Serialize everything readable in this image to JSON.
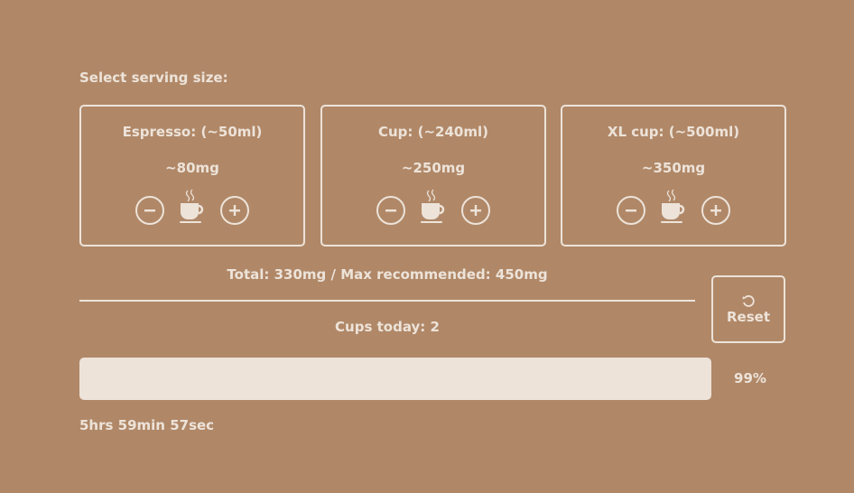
{
  "select_label": "Select serving size:",
  "servings": [
    {
      "title": "Espresso: (~50ml)",
      "caffeine": "~80mg"
    },
    {
      "title": "Cup: (~240ml)",
      "caffeine": "~250mg"
    },
    {
      "title": "XL cup: (~500ml)",
      "caffeine": "~350mg"
    }
  ],
  "total_text": "Total: 330mg / Max recommended: 450mg",
  "cups_today": "Cups today: 2",
  "reset_label": "Reset",
  "progress": {
    "percent": 99,
    "label": "99%"
  },
  "timer": "5hrs 59min 57sec",
  "colors": {
    "background": "#b08868",
    "foreground": "#ede3d9"
  }
}
